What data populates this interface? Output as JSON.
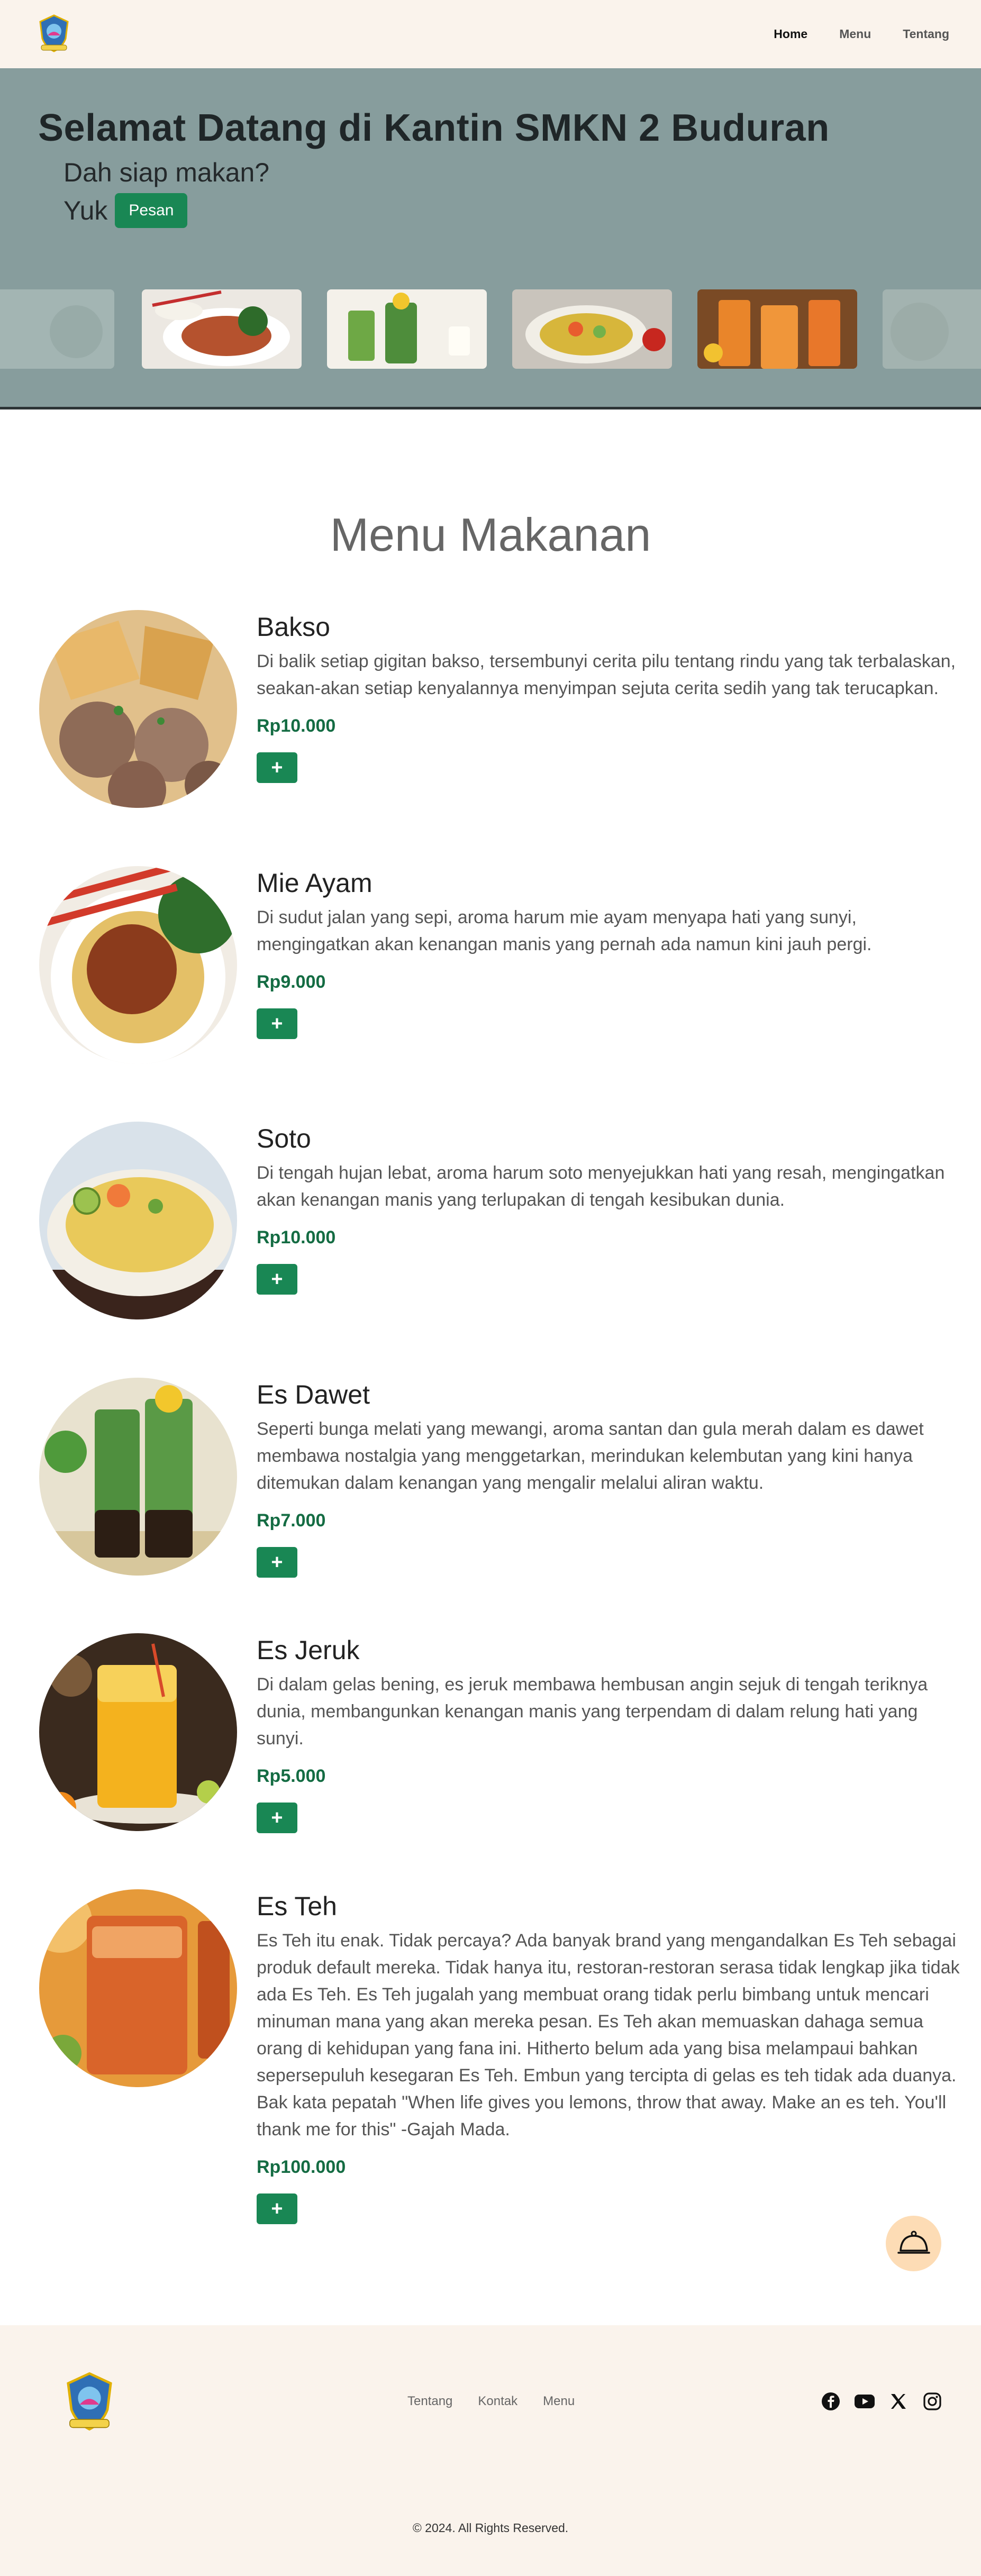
{
  "nav": {
    "links": [
      {
        "label": "Home",
        "active": true
      },
      {
        "label": "Menu",
        "active": false
      },
      {
        "label": "Tentang",
        "active": false
      }
    ]
  },
  "hero": {
    "title": "Selamat Datang di Kantin SMKN 2 Buduran",
    "subtitle": "Dah siap makan?",
    "cta_prefix": "Yuk",
    "cta_button": "Pesan"
  },
  "menu": {
    "heading": "Menu Makanan",
    "add_label": "+",
    "items": [
      {
        "name": "Bakso",
        "desc": "Di balik setiap gigitan bakso, tersembunyi cerita pilu tentang rindu yang tak terbalaskan, seakan-akan setiap kenyalannya menyimpan sejuta cerita sedih yang tak terucapkan.",
        "price": "Rp10.000"
      },
      {
        "name": "Mie Ayam",
        "desc": "Di sudut jalan yang sepi, aroma harum mie ayam menyapa hati yang sunyi, mengingatkan akan kenangan manis yang pernah ada namun kini jauh pergi.",
        "price": "Rp9.000"
      },
      {
        "name": "Soto",
        "desc": "Di tengah hujan lebat, aroma harum soto menyejukkan hati yang resah, mengingatkan akan kenangan manis yang terlupakan di tengah kesibukan dunia.",
        "price": "Rp10.000"
      },
      {
        "name": "Es Dawet",
        "desc": "Seperti bunga melati yang mewangi, aroma santan dan gula merah dalam es dawet membawa nostalgia yang menggetarkan, merindukan kelembutan yang kini hanya ditemukan dalam kenangan yang mengalir melalui aliran waktu.",
        "price": "Rp7.000"
      },
      {
        "name": "Es Jeruk",
        "desc": "Di dalam gelas bening, es jeruk membawa hembusan angin sejuk di tengah teriknya dunia, membangunkan kenangan manis yang terpendam di dalam relung hati yang sunyi.",
        "price": "Rp5.000"
      },
      {
        "name": "Es Teh",
        "desc": "Es Teh itu enak. Tidak percaya? Ada banyak brand yang mengandalkan Es Teh sebagai produk default mereka. Tidak hanya itu, restoran-restoran serasa tidak lengkap jika tidak ada Es Teh. Es Teh jugalah yang membuat orang tidak perlu bimbang untuk mencari minuman mana yang akan mereka pesan. Es Teh akan memuaskan dahaga semua orang di kehidupan yang fana ini. Hitherto belum ada yang bisa melampaui bahkan sepersepuluh kesegaran Es Teh. Embun yang tercipta di gelas es teh tidak ada duanya. Bak kata pepatah \"When life gives you lemons, throw that away. Make an es teh. You'll thank me for this\" -Gajah Mada.",
        "price": "Rp100.000"
      }
    ]
  },
  "footer": {
    "links": [
      "Tentang",
      "Kontak",
      "Menu"
    ],
    "social": [
      "facebook-icon",
      "youtube-icon",
      "x-icon",
      "instagram-icon"
    ],
    "copyright": "© 2024. All Rights Reserved."
  },
  "colors": {
    "hero_bg": "#879d9d",
    "nav_bg": "#faf3ec",
    "accent_green": "#198754",
    "price_green": "#146c43",
    "cart_fab": "#fddcb5"
  }
}
